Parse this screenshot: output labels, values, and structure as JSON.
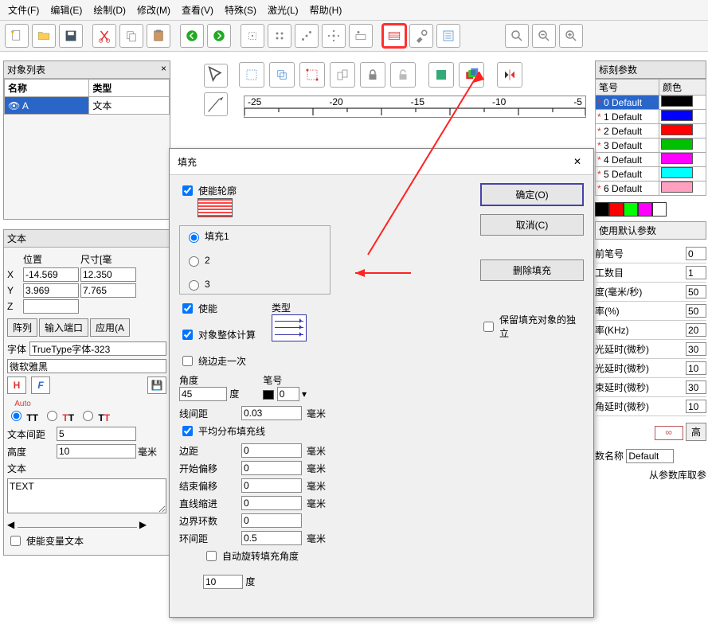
{
  "menu": {
    "file": "文件(F)",
    "edit": "编辑(E)",
    "draw": "绘制(D)",
    "modify": "修改(M)",
    "view": "查看(V)",
    "special": "特殊(S)",
    "laser": "激光(L)",
    "help": "帮助(H)"
  },
  "left": {
    "obj_list_title": "对象列表",
    "col_name": "名称",
    "col_type": "类型",
    "row_icon": "A",
    "row_type": "文本",
    "text_title": "文本",
    "position": "位置",
    "size": "尺寸[毫",
    "X": "X",
    "Y": "Y",
    "Z": "Z",
    "pos_x": "-14.569",
    "size_x": "12.350",
    "pos_y": "3.969",
    "size_y": "7.765",
    "pos_z": "",
    "array": "阵列",
    "ioport": "输入端口",
    "apply": "应用(A",
    "font_label": "字体",
    "font_sel": "TrueType字体-323",
    "font_name": "微软雅黑",
    "auto": "Auto",
    "text_spacing_label": "文本间距",
    "text_spacing": "5",
    "height_label": "高度",
    "height": "10",
    "height_unit": "毫米",
    "text_label": "文本",
    "text_content": "TEXT",
    "enable_var": "使能变量文本"
  },
  "dialog": {
    "title": "填充",
    "enable_outline": "使能轮廓",
    "fill": "填充1",
    "opt2": "2",
    "opt3": "3",
    "enable": "使能",
    "obj_whole": "对象整体计算",
    "around_once": "绕边走一次",
    "type_label": "类型",
    "angle_label": "角度",
    "angle": "45",
    "deg": "度",
    "pen_label": "笔号",
    "pen": "0",
    "line_spacing_label": "线间距",
    "line_spacing": "0.03",
    "mm": "毫米",
    "avg_dist": "平均分布填充线",
    "margin_label": "边距",
    "margin": "0",
    "start_off_label": "开始偏移",
    "start_off": "0",
    "end_off_label": "结束偏移",
    "end_off": "0",
    "indent_label": "直线缩进",
    "indent": "0",
    "loops_label": "边界环数",
    "loops": "0",
    "loop_sp_label": "环间距",
    "loop_sp": "0.5",
    "auto_rotate": "自动旋转填充角度",
    "auto_rotate_val": "10",
    "ok": "确定(O)",
    "cancel": "取消(C)",
    "delete": "删除填充",
    "keep_indep": "保留填充对象的独立"
  },
  "right": {
    "panel_title": "标刻参数",
    "col_pen": "笔号",
    "col_color": "颜色",
    "pens": [
      {
        "label": "0 Default",
        "color": "#000000",
        "sel": true
      },
      {
        "label": "1 Default",
        "color": "#0000ff"
      },
      {
        "label": "2 Default",
        "color": "#ff0000"
      },
      {
        "label": "3 Default",
        "color": "#00c000"
      },
      {
        "label": "4 Default",
        "color": "#ff00ff"
      },
      {
        "label": "5 Default",
        "color": "#00ffff"
      },
      {
        "label": "6 Default",
        "color": "#ffa0c0"
      }
    ],
    "use_default": "使用默认参数",
    "params": [
      {
        "label": "前笔号",
        "val": "0"
      },
      {
        "label": "工数目",
        "val": "1"
      },
      {
        "label": "度(毫米/秒)",
        "val": "50"
      },
      {
        "label": "率(%)",
        "val": "50"
      },
      {
        "label": "率(KHz)",
        "val": "20"
      },
      {
        "label": "光延时(微秒)",
        "val": "30"
      },
      {
        "label": "光延时(微秒)",
        "val": "10"
      },
      {
        "label": "束延时(微秒)",
        "val": "30"
      },
      {
        "label": "角延时(微秒)",
        "val": "10"
      }
    ],
    "adv": "高",
    "param_name_label": "数名称",
    "param_name": "Default",
    "from_lib": "从参数库取参"
  },
  "ruler": {
    "m25": "-25",
    "m20": "-20",
    "m15": "-15",
    "m10": "-10",
    "m5": "-5"
  }
}
